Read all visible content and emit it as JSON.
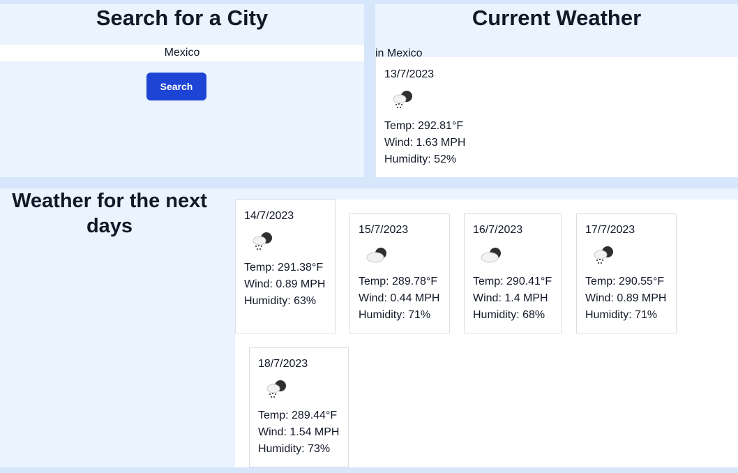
{
  "search": {
    "title": "Search for a City",
    "input_value": "Mexico",
    "button_label": "Search"
  },
  "current": {
    "title": "Current Weather",
    "city_text": "in Mexico",
    "date": "13/7/2023",
    "icon": "rain-cloud-icon",
    "temp": "Temp: 292.81°F",
    "wind": "Wind: 1.63 MPH",
    "humidity": "Humidity: 52%"
  },
  "forecast": {
    "title_line1": "Weather for the next",
    "title_line2": "days",
    "days": [
      {
        "date": "14/7/2023",
        "icon": "rain-cloud-icon",
        "temp": "Temp: 291.38°F",
        "wind": "Wind: 0.89 MPH",
        "humidity": "Humidity: 63%"
      },
      {
        "date": "15/7/2023",
        "icon": "cloudy-icon",
        "temp": "Temp: 289.78°F",
        "wind": "Wind: 0.44 MPH",
        "humidity": "Humidity: 71%"
      },
      {
        "date": "16/7/2023",
        "icon": "cloudy-icon",
        "temp": "Temp: 290.41°F",
        "wind": "Wind: 1.4 MPH",
        "humidity": "Humidity: 68%"
      },
      {
        "date": "17/7/2023",
        "icon": "rain-cloud-icon",
        "temp": "Temp: 290.55°F",
        "wind": "Wind: 0.89 MPH",
        "humidity": "Humidity: 71%"
      },
      {
        "date": "18/7/2023",
        "icon": "rain-cloud-icon",
        "temp": "Temp: 289.44°F",
        "wind": "Wind: 1.54 MPH",
        "humidity": "Humidity: 73%"
      }
    ]
  }
}
